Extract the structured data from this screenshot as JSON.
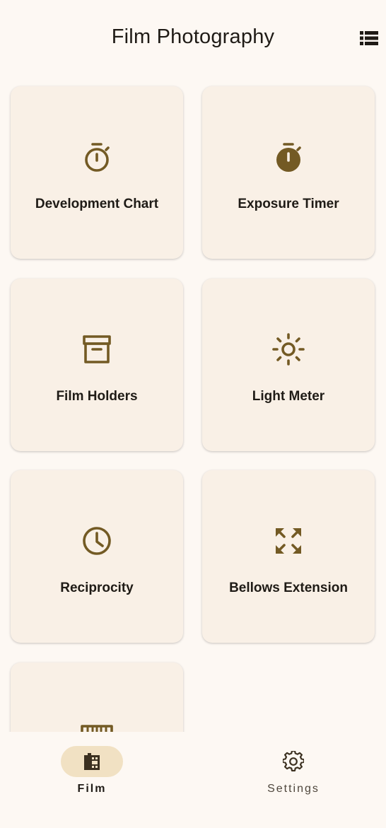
{
  "app_bar": {
    "title": "Film Photography",
    "view_toggle_icon": "view-list-icon"
  },
  "cards": [
    {
      "label": "Development Chart",
      "icon": "timer-outline-icon"
    },
    {
      "label": "Exposure Timer",
      "icon": "timer-filled-icon"
    },
    {
      "label": "Film Holders",
      "icon": "archive-icon"
    },
    {
      "label": "Light Meter",
      "icon": "sun-icon"
    },
    {
      "label": "Reciprocity",
      "icon": "clock-icon"
    },
    {
      "label": "Bellows Extension",
      "icon": "expand-icon"
    },
    {
      "label": "",
      "icon": "ruler-icon"
    }
  ],
  "nav": {
    "film": {
      "label": "Film",
      "icon": "film-roll-icon",
      "selected": true
    },
    "settings": {
      "label": "Settings",
      "icon": "gear-icon",
      "selected": false
    }
  },
  "colors": {
    "background": "#fdf8f3",
    "card": "#f9f0e6",
    "accent": "#735a24",
    "nav_indicator": "#f1e1c3",
    "text": "#1f1b16"
  }
}
